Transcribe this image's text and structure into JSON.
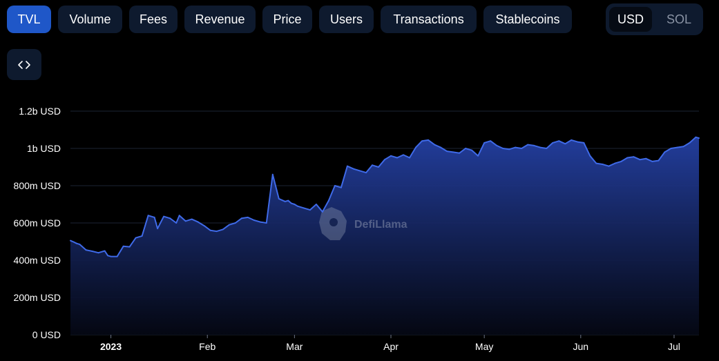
{
  "metric_tabs": [
    {
      "label": "TVL",
      "active": true
    },
    {
      "label": "Volume",
      "active": false
    },
    {
      "label": "Fees",
      "active": false
    },
    {
      "label": "Revenue",
      "active": false
    },
    {
      "label": "Price",
      "active": false
    },
    {
      "label": "Users",
      "active": false
    },
    {
      "label": "Transactions",
      "active": false
    },
    {
      "label": "Stablecoins",
      "active": false
    }
  ],
  "currency_toggle": {
    "selected": "USD",
    "options": [
      "USD",
      "SOL"
    ]
  },
  "embed_icon": "code-brackets-icon",
  "watermark_text": "DefiLlama",
  "colors": {
    "line": "#3f6ae8",
    "fill_top": "#2440a3",
    "grid": "#1b2333",
    "tab_active": "#1f57c8"
  },
  "chart_data": {
    "type": "area",
    "title": "",
    "xlabel": "",
    "ylabel": "",
    "ylim": [
      0,
      1200000000
    ],
    "y_ticks": [
      {
        "value": 0,
        "label": "0 USD"
      },
      {
        "value": 200000000,
        "label": "200m USD"
      },
      {
        "value": 400000000,
        "label": "400m USD"
      },
      {
        "value": 600000000,
        "label": "600m USD"
      },
      {
        "value": 800000000,
        "label": "800m USD"
      },
      {
        "value": 1000000000,
        "label": "1b USD"
      },
      {
        "value": 1200000000,
        "label": "1.2b USD"
      }
    ],
    "xlim": [
      "2022-12-19",
      "2023-07-09"
    ],
    "x_ticks": [
      {
        "date": "2023-01-01",
        "label": "2023",
        "bold": true
      },
      {
        "date": "2023-02-01",
        "label": "Feb",
        "bold": false
      },
      {
        "date": "2023-03-01",
        "label": "Mar",
        "bold": false
      },
      {
        "date": "2023-04-01",
        "label": "Apr",
        "bold": false
      },
      {
        "date": "2023-05-01",
        "label": "May",
        "bold": false
      },
      {
        "date": "2023-06-01",
        "label": "Jun",
        "bold": false
      },
      {
        "date": "2023-07-01",
        "label": "Jul",
        "bold": false
      }
    ],
    "grid": true,
    "series": [
      {
        "x": [
          "2022-12-19",
          "2022-12-20",
          "2022-12-21",
          "2022-12-22",
          "2022-12-24",
          "2022-12-26",
          "2022-12-28",
          "2022-12-30",
          "2022-12-31",
          "2023-01-01",
          "2023-01-03",
          "2023-01-05",
          "2023-01-07",
          "2023-01-09",
          "2023-01-11",
          "2023-01-13",
          "2023-01-15",
          "2023-01-16",
          "2023-01-18",
          "2023-01-20",
          "2023-01-22",
          "2023-01-23",
          "2023-01-25",
          "2023-01-27",
          "2023-01-29",
          "2023-01-31",
          "2023-02-02",
          "2023-02-04",
          "2023-02-06",
          "2023-02-08",
          "2023-02-10",
          "2023-02-12",
          "2023-02-14",
          "2023-02-16",
          "2023-02-18",
          "2023-02-20",
          "2023-02-22",
          "2023-02-24",
          "2023-02-26",
          "2023-02-27",
          "2023-02-28",
          "2023-03-01",
          "2023-03-02",
          "2023-03-04",
          "2023-03-06",
          "2023-03-08",
          "2023-03-10",
          "2023-03-12",
          "2023-03-13",
          "2023-03-14",
          "2023-03-16",
          "2023-03-18",
          "2023-03-20",
          "2023-03-22",
          "2023-03-24",
          "2023-03-26",
          "2023-03-28",
          "2023-03-30",
          "2023-04-01",
          "2023-04-03",
          "2023-04-05",
          "2023-04-07",
          "2023-04-09",
          "2023-04-11",
          "2023-04-13",
          "2023-04-15",
          "2023-04-17",
          "2023-04-19",
          "2023-04-21",
          "2023-04-23",
          "2023-04-25",
          "2023-04-27",
          "2023-04-29",
          "2023-05-01",
          "2023-05-03",
          "2023-05-05",
          "2023-05-07",
          "2023-05-09",
          "2023-05-11",
          "2023-05-13",
          "2023-05-15",
          "2023-05-17",
          "2023-05-19",
          "2023-05-21",
          "2023-05-23",
          "2023-05-25",
          "2023-05-27",
          "2023-05-29",
          "2023-05-31",
          "2023-06-02",
          "2023-06-04",
          "2023-06-06",
          "2023-06-08",
          "2023-06-10",
          "2023-06-12",
          "2023-06-14",
          "2023-06-16",
          "2023-06-18",
          "2023-06-20",
          "2023-06-22",
          "2023-06-24",
          "2023-06-26",
          "2023-06-28",
          "2023-06-30",
          "2023-07-02",
          "2023-07-04",
          "2023-07-06",
          "2023-07-08",
          "2023-07-09"
        ],
        "values": [
          505000000,
          498000000,
          490000000,
          485000000,
          455000000,
          448000000,
          440000000,
          450000000,
          425000000,
          420000000,
          420000000,
          475000000,
          472000000,
          520000000,
          530000000,
          640000000,
          630000000,
          570000000,
          635000000,
          625000000,
          600000000,
          640000000,
          610000000,
          620000000,
          605000000,
          585000000,
          560000000,
          555000000,
          565000000,
          590000000,
          600000000,
          625000000,
          630000000,
          615000000,
          605000000,
          600000000,
          860000000,
          730000000,
          715000000,
          720000000,
          705000000,
          700000000,
          690000000,
          680000000,
          670000000,
          700000000,
          660000000,
          720000000,
          760000000,
          800000000,
          790000000,
          905000000,
          890000000,
          880000000,
          870000000,
          910000000,
          900000000,
          940000000,
          960000000,
          950000000,
          965000000,
          950000000,
          1005000000,
          1040000000,
          1045000000,
          1020000000,
          1005000000,
          985000000,
          980000000,
          975000000,
          1000000000,
          990000000,
          960000000,
          1030000000,
          1040000000,
          1015000000,
          1000000000,
          995000000,
          1005000000,
          1000000000,
          1020000000,
          1015000000,
          1005000000,
          1000000000,
          1030000000,
          1040000000,
          1025000000,
          1045000000,
          1035000000,
          1030000000,
          960000000,
          920000000,
          915000000,
          905000000,
          920000000,
          930000000,
          950000000,
          955000000,
          940000000,
          945000000,
          930000000,
          935000000,
          980000000,
          1000000000,
          1005000000,
          1010000000,
          1030000000,
          1060000000,
          1055000000
        ]
      }
    ]
  }
}
